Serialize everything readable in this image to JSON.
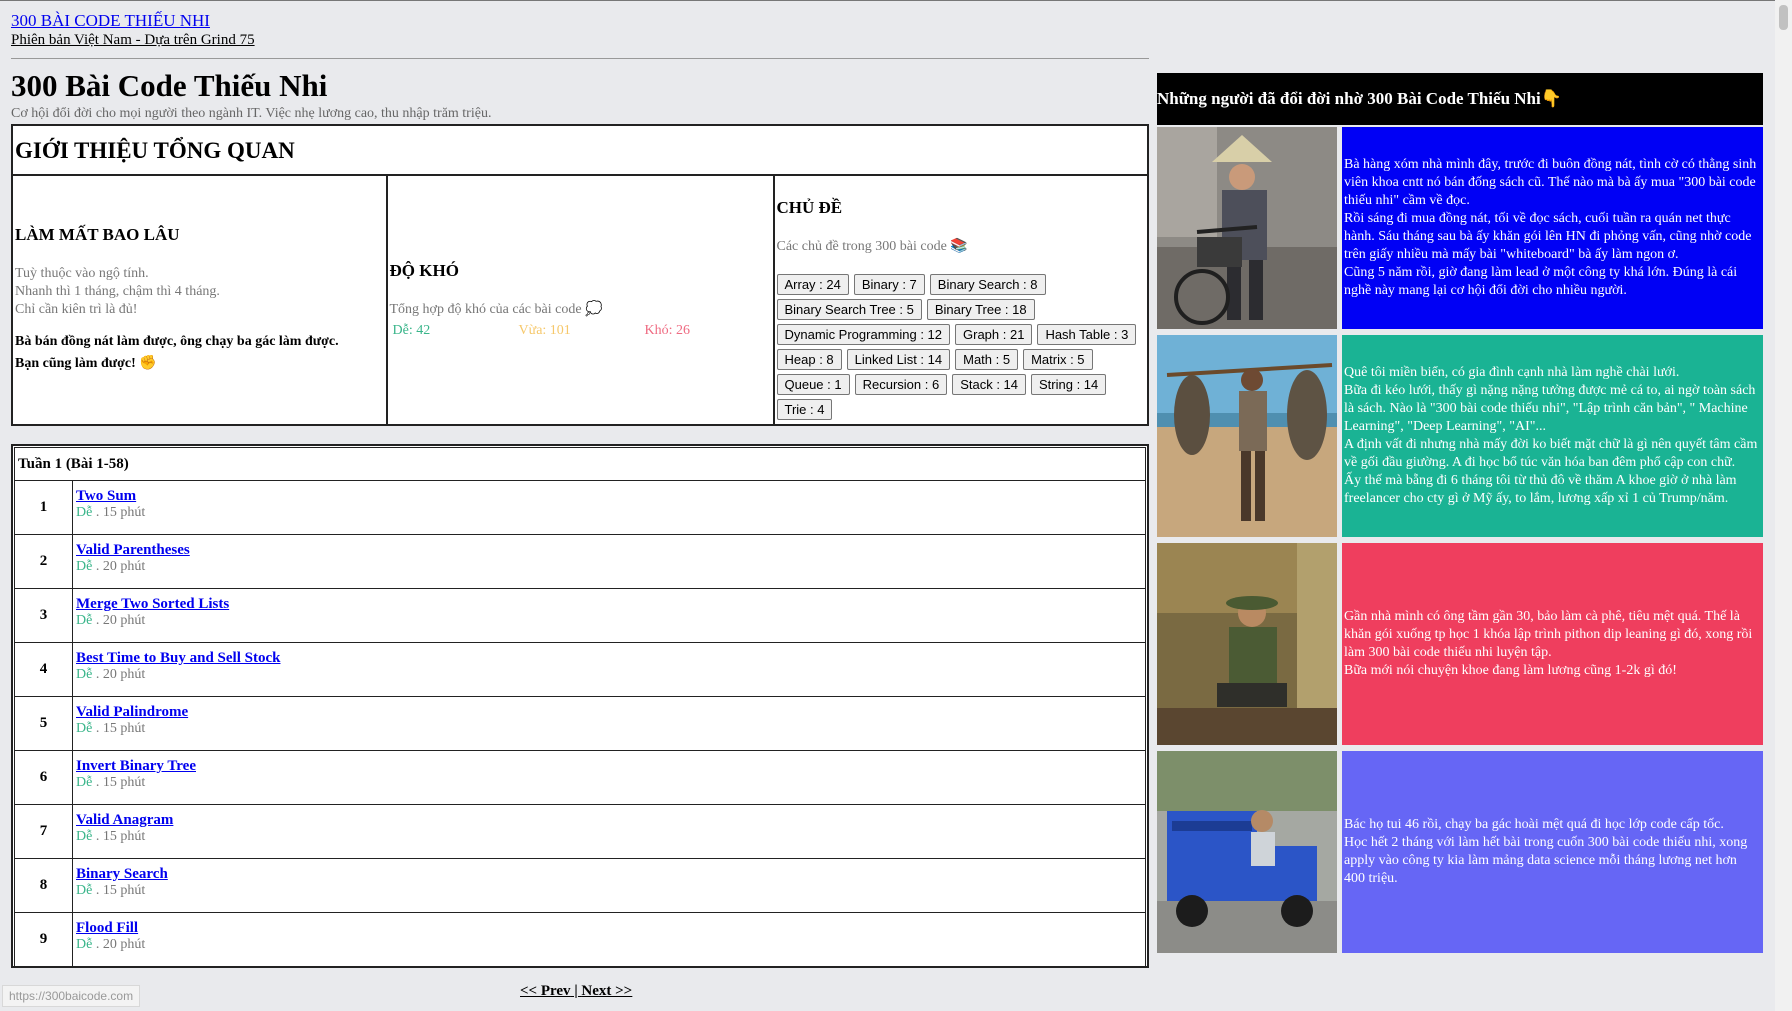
{
  "header": {
    "site_title": "300 BÀI CODE THIẾU NHI",
    "site_subtitle": "Phiên bản Việt Nam - Dựa trên Grind 75",
    "page_title": "300 Bài Code Thiếu Nhi",
    "page_desc": "Cơ hội đổi đời cho mọi người theo ngành IT. Việc nhẹ lương cao, thu nhập trăm triệu."
  },
  "overview": {
    "heading": "GIỚI THIỆU TỔNG QUAN",
    "duration": {
      "title": "LÀM MẤT BAO LÂU",
      "lines": [
        "Tuỳ thuộc vào ngộ tính.",
        "Nhanh thì 1 tháng, chậm thì 4 tháng.",
        "Chỉ cần kiên trì là đủ!"
      ],
      "bold_lines": [
        "Bà bán đồng nát làm được, ông chạy ba gác làm được.",
        "Bạn cũng làm được! ✊"
      ]
    },
    "difficulty": {
      "title": "ĐỘ KHÓ",
      "desc": "Tổng hợp độ khó của các bài code 💭",
      "easy": "Dễ: 42",
      "medium": "Vừa: 101",
      "hard": "Khó: 26"
    },
    "topics": {
      "title": "CHỦ ĐỀ",
      "desc": "Các chủ đề trong 300 bài code 📚",
      "tags": [
        "Array : 24",
        "Binary : 7",
        "Binary Search : 8",
        "Binary Search Tree : 5",
        "Binary Tree : 18",
        "Dynamic Programming : 12",
        "Graph : 21",
        "Hash Table : 3",
        "Heap : 8",
        "Linked List : 14",
        "Math : 5",
        "Matrix : 5",
        "Queue : 1",
        "Recursion : 6",
        "Stack : 14",
        "String : 14",
        "Trie : 4"
      ]
    }
  },
  "week": {
    "title": "Tuần 1 (Bài 1-58)",
    "problems": [
      {
        "num": "1",
        "name": "Two Sum",
        "level": "Dễ",
        "time": " . 15 phút"
      },
      {
        "num": "2",
        "name": "Valid Parentheses",
        "level": "Dễ",
        "time": " . 20 phút"
      },
      {
        "num": "3",
        "name": "Merge Two Sorted Lists",
        "level": "Dễ",
        "time": " . 20 phút"
      },
      {
        "num": "4",
        "name": "Best Time to Buy and Sell Stock",
        "level": "Dễ",
        "time": " . 20 phút"
      },
      {
        "num": "5",
        "name": "Valid Palindrome",
        "level": "Dễ",
        "time": " . 15 phút"
      },
      {
        "num": "6",
        "name": "Invert Binary Tree",
        "level": "Dễ",
        "time": " . 15 phút"
      },
      {
        "num": "7",
        "name": "Valid Anagram",
        "level": "Dễ",
        "time": " . 15 phút"
      },
      {
        "num": "8",
        "name": "Binary Search",
        "level": "Dễ",
        "time": " . 15 phút"
      },
      {
        "num": "9",
        "name": "Flood Fill",
        "level": "Dễ",
        "time": " . 20 phút"
      }
    ]
  },
  "pager": {
    "prev": "<< Prev",
    "sep": " | ",
    "next": "Next >>"
  },
  "status_url": "https://300baicode.com",
  "testimonials": {
    "heading": "Những người đã đổi đời nhờ 300 Bài Code Thiếu Nhi👇",
    "items": [
      {
        "color": "#0000f5",
        "text": "Bà hàng xóm nhà mình đây, trước đi buôn đồng nát, tình cờ có thằng sinh viên khoa cntt nó bán đống sách cũ. Thế nào mà bà ấy mua \"300 bài code thiếu nhi\" cầm về đọc.\nRồi sáng đi mua đồng nát, tối về đọc sách, cuối tuần ra quán net thực hành. Sáu tháng sau bà ấy khăn gói lên HN đi phỏng vấn, cũng nhờ code trên giấy nhiều mà mấy bài \"whiteboard\" bà ấy làm ngon ơ.\nCũng 5 năm rồi, giờ đang làm lead ở một công ty khá lớn. Đúng là cái nghề này mang lại cơ hội đổi đời cho nhiều người."
      },
      {
        "color": "#1ab394",
        "text": "Quê tôi miền biển, có gia đình cạnh nhà làm nghề chài lưới.\nBữa đi kéo lưới, thấy gì nặng nặng tưởng được mẻ cá to, ai ngờ toàn sách là sách. Nào là \"300 bài code thiếu nhi\", \"Lập trình căn bản\", \" Machine Learning\", \"Deep Learning\", \"AI\"...\nA định vất đi nhưng nhà mấy đời ko biết mặt chữ là gì nên quyết tâm cầm về gối đầu giường. A đi học bổ túc văn hóa ban đêm phổ cập con chữ.\nẤy thế mà bẵng đi 6 tháng tôi từ thủ đô về thăm A khoe giờ ở nhà làm freelancer cho cty gì ở Mỹ ấy, to lắm, lương xấp xỉ 1 củ Trump/năm."
      },
      {
        "color": "#ef3e5e",
        "text": "Gần nhà mình có ông tầm gần 30, bảo làm cà phê, tiêu mệt quá. Thế là khăn gói xuống tp học 1 khóa lập trình pithon dip leaning gì đó, xong rồi làm 300 bài code thiếu nhi luyện tập.\nBữa mới nói chuyện khoe đang làm lương cũng 1-2k gì đó!"
      },
      {
        "color": "#6666f5",
        "text": "Bác họ tui 46 rồi, chạy ba gác hoài mệt quá đi học lớp code cấp tốc.\nHọc hết 2 tháng với làm hết bài trong cuốn 300 bài code thiếu nhi, xong apply vào công ty kia làm mảng data science mỗi tháng lương net hơn 400 triệu."
      }
    ]
  }
}
